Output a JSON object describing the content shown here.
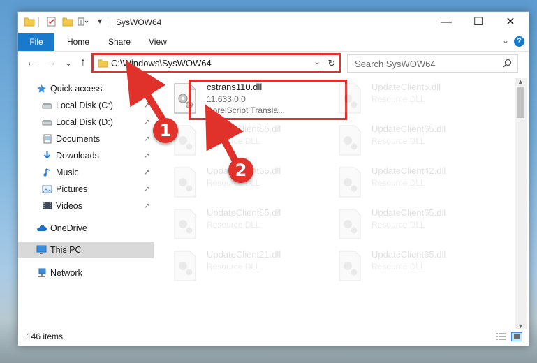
{
  "window": {
    "title": "SysWOW64",
    "minimize_glyph": "—",
    "maximize_glyph": "☐",
    "close_glyph": "✕"
  },
  "ribbon": {
    "tabs": [
      "File",
      "Home",
      "Share",
      "View"
    ],
    "help_glyph": "?"
  },
  "nav": {
    "back_glyph": "←",
    "forward_glyph": "→",
    "recent_glyph": "⌄",
    "up_glyph": "↑",
    "address": "C:\\Windows\\SysWOW64",
    "address_dropdown_glyph": "⌄",
    "refresh_glyph": "↻",
    "search_placeholder": "Search SysWOW64"
  },
  "sidebar": {
    "items": [
      {
        "label": "Quick access",
        "icon": "star-icon",
        "pinned": false
      },
      {
        "label": "Local Disk (C:)",
        "icon": "drive-icon",
        "pinned": true
      },
      {
        "label": "Local Disk (D:)",
        "icon": "drive-icon",
        "pinned": true
      },
      {
        "label": "Documents",
        "icon": "documents-icon",
        "pinned": true
      },
      {
        "label": "Downloads",
        "icon": "download-icon",
        "pinned": true
      },
      {
        "label": "Music",
        "icon": "music-icon",
        "pinned": true
      },
      {
        "label": "Pictures",
        "icon": "pictures-icon",
        "pinned": true
      },
      {
        "label": "Videos",
        "icon": "videos-icon",
        "pinned": true
      },
      {
        "label": "OneDrive",
        "icon": "cloud-icon",
        "pinned": false
      },
      {
        "label": "This PC",
        "icon": "computer-icon",
        "pinned": false,
        "selected": true
      },
      {
        "label": "Network",
        "icon": "network-icon",
        "pinned": false
      }
    ],
    "pin_glyph": "📌"
  },
  "files": {
    "highlighted": {
      "name": "cstrans110.dll",
      "version": "11.633.0.0",
      "description": "CorelScript Transla..."
    },
    "faded": [
      {
        "name": "UpdateClient5.dll",
        "type": "Resource DLL"
      },
      {
        "name": "UpdateClient65.dll",
        "type": "Resource DLL"
      },
      {
        "name": "UpdateClient65.dll",
        "type": "Resource DLL"
      },
      {
        "name": "UpdateClient65.dll",
        "type": "Resource DLL"
      },
      {
        "name": "UpdateClient42.dll",
        "type": "Resource DLL"
      },
      {
        "name": "UpdateClient65.dll",
        "type": "Resource DLL"
      },
      {
        "name": "UpdateClient65.dll",
        "type": "Resource DLL"
      },
      {
        "name": "UpdateClient21.dll",
        "type": "Resource DLL"
      },
      {
        "name": "UpdateClient65.dll",
        "type": "Resource DLL"
      }
    ]
  },
  "status": {
    "items_count": "146 items"
  },
  "callouts": {
    "first": "1",
    "second": "2"
  },
  "colors": {
    "accent": "#1979ca",
    "highlight": "#e0312b"
  }
}
